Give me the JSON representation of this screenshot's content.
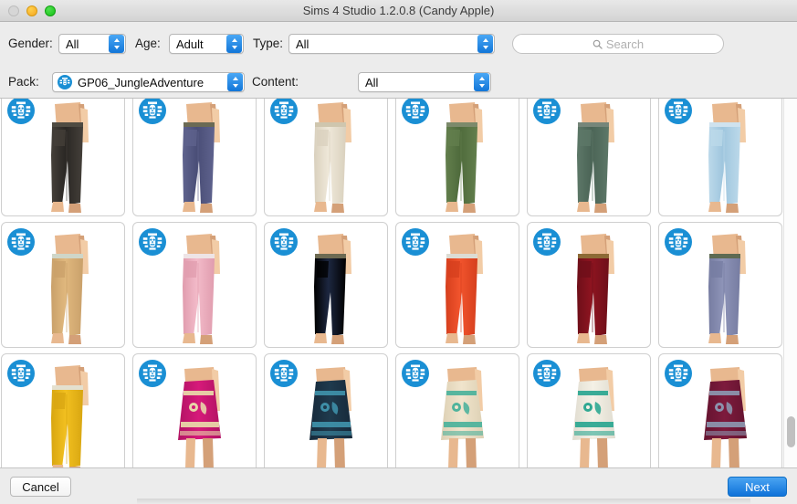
{
  "window": {
    "title": "Sims 4 Studio 1.2.0.8 (Candy Apple)",
    "controls": {
      "close": "close-button",
      "minimize": "minimize-button",
      "zoom": "zoom-button"
    }
  },
  "filters": {
    "gender": {
      "label": "Gender:",
      "value": "All"
    },
    "age": {
      "label": "Age:",
      "value": "Adult"
    },
    "type": {
      "label": "Type:",
      "value": "All"
    },
    "pack": {
      "label": "Pack:",
      "value": "GP06_JungleAdventure",
      "icon": "jungle-pack-icon"
    },
    "content": {
      "label": "Content:",
      "value": "All"
    }
  },
  "search": {
    "placeholder": "Search",
    "value": "",
    "icon": "search-icon"
  },
  "accent_colors": {
    "stepper_blue": "#1276d8",
    "badge_blue": "#1a8fd4",
    "next_button_blue": "#0f72d9"
  },
  "grid": {
    "badge_icon": "tiki-mask-icon",
    "items": [
      {
        "name": "black-pants",
        "garment": "pants",
        "color": "#2a2724",
        "shade": "#45403a",
        "waist": "#4f4b42"
      },
      {
        "name": "navy-blue-pants",
        "garment": "pants",
        "color": "#4a4e77",
        "shade": "#5f638e",
        "waist": "#6b6a54"
      },
      {
        "name": "cream-white-pants",
        "garment": "pants",
        "color": "#efe8d9",
        "shade": "#d9d0bd",
        "waist": "#cfc6ae"
      },
      {
        "name": "olive-green-pants",
        "garment": "pants",
        "color": "#4f6b3c",
        "shade": "#637f4d",
        "waist": "#7c8a6b"
      },
      {
        "name": "dark-sage-pants",
        "garment": "pants",
        "color": "#4b6456",
        "shade": "#5d7868",
        "waist": "#76867a"
      },
      {
        "name": "light-blue-pants",
        "garment": "pants",
        "color": "#9fc6de",
        "shade": "#bcd9ea",
        "waist": "#cfe2ee"
      },
      {
        "name": "tan-khaki-pants",
        "garment": "pants",
        "color": "#e0b87e",
        "shade": "#c9a06a",
        "waist": "#cfd6c8"
      },
      {
        "name": "pink-pants",
        "garment": "pants",
        "color": "#f3bbc9",
        "shade": "#e09cae",
        "waist": "#eee4e6"
      },
      {
        "name": "dark-navy-pants",
        "garment": "pants",
        "color": "#1d2740",
        "shade": "#2c3category",
        "waist": "#6d6a52"
      },
      {
        "name": "orange-pants",
        "garment": "pants",
        "color": "#f2542d",
        "shade": "#d53f1d",
        "waist": "#dcdcd4"
      },
      {
        "name": "dark-red-pants",
        "garment": "pants",
        "color": "#8e1420",
        "shade": "#6e0f19",
        "waist": "#8d6a35"
      },
      {
        "name": "periwinkle-pants",
        "garment": "pants",
        "color": "#8e94b8",
        "shade": "#767ca1",
        "waist": "#5e6a52"
      },
      {
        "name": "yellow-pants",
        "garment": "pants",
        "color": "#f2c020",
        "shade": "#d8a611",
        "waist": "#e4e0cf"
      },
      {
        "name": "magenta-skirt",
        "garment": "skirt",
        "color": "#d61a7a",
        "shade": "#b21263",
        "trim": "#e8d6a8"
      },
      {
        "name": "dark-teal-skirt",
        "garment": "skirt",
        "color": "#1f3a4d",
        "shade": "#16293a",
        "trim": "#3e8fa8"
      },
      {
        "name": "cream-floral-skirt",
        "garment": "skirt",
        "color": "#f0e4cc",
        "shade": "#ddd0b4",
        "trim": "#4fb39c"
      },
      {
        "name": "white-teal-skirt",
        "garment": "skirt",
        "color": "#f4f1e6",
        "shade": "#e0dcd0",
        "trim": "#2fa892"
      },
      {
        "name": "maroon-gray-skirt",
        "garment": "skirt",
        "color": "#7d1b3d",
        "shade": "#64132f",
        "trim": "#8b93ad"
      }
    ]
  },
  "scrollbar": {
    "name": "vertical-scrollbar"
  },
  "footer": {
    "cancel_label": "Cancel",
    "next_label": "Next"
  }
}
